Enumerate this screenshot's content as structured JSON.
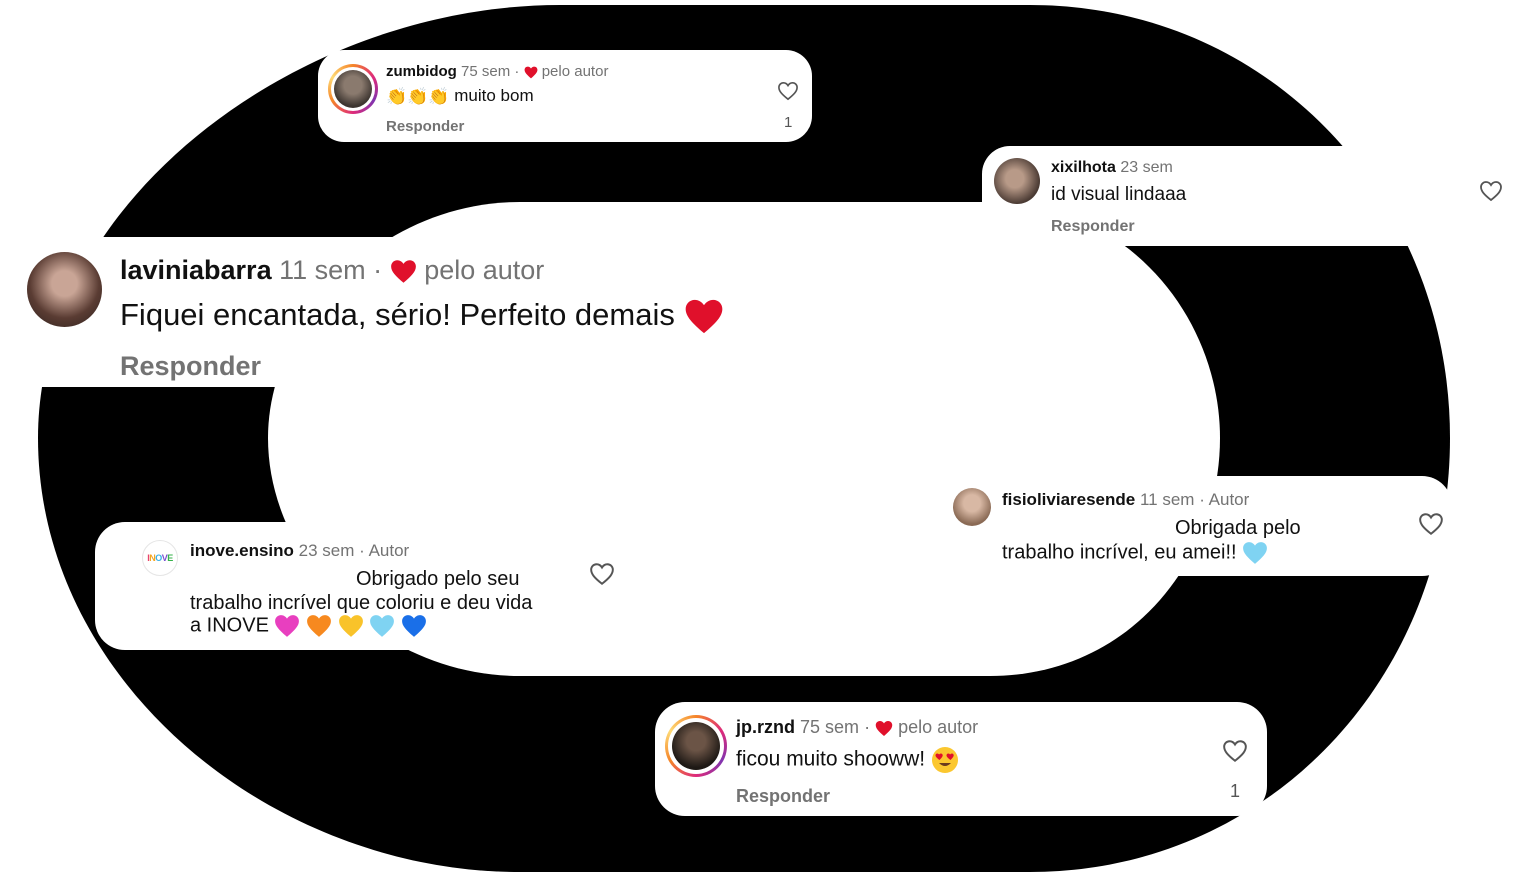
{
  "comments": [
    {
      "username": "zumbidog",
      "age": "75 sem",
      "separator": "·",
      "author_tag": "pelo autor",
      "text": "muito bom",
      "emoji_prefix": [
        "clapping-hands",
        "clapping-hands",
        "clapping-hands"
      ],
      "reply": "Responder",
      "likes": "1",
      "has_story_ring": true
    },
    {
      "username": "xixilhota",
      "age": "23 sem",
      "text": "id visual lindaaa",
      "reply": "Responder",
      "has_story_ring": false
    },
    {
      "username": "laviniabarra",
      "age": "11 sem",
      "separator": "·",
      "author_tag": "pelo autor",
      "text": "Fiquei encantada, sério! Perfeito demais",
      "emoji_suffix": [
        "red-heart"
      ],
      "reply": "Responder",
      "has_story_ring": false
    },
    {
      "username": "fisioliviaresende",
      "age": "11 sem",
      "author_tag": "· Autor",
      "text_line1": "Obrigada pelo",
      "text_line2": "trabalho incrível, eu amei!!",
      "emoji_suffix": [
        "light-blue-heart"
      ],
      "has_story_ring": false
    },
    {
      "username": "inove.ensino",
      "age": "23 sem",
      "author_tag": "· Autor",
      "text_line1": "Obrigado pelo seu",
      "text_line2": "trabalho incrível que coloriu e deu vida",
      "text_line3": "a INOVE",
      "emoji_suffix": [
        "pink-heart",
        "orange-heart",
        "yellow-heart",
        "light-blue-heart",
        "blue-heart"
      ],
      "avatar_logo": "INOVE",
      "has_story_ring": false
    },
    {
      "username": "jp.rznd",
      "age": "75 sem",
      "separator": "·",
      "author_tag": "pelo autor",
      "text": "ficou muito shooww!",
      "emoji_suffix": [
        "heart-eyes-face"
      ],
      "reply": "Responder",
      "likes": "1",
      "has_story_ring": true
    }
  ],
  "colors": {
    "background_shape": "#000000",
    "card": "#ffffff",
    "author_heart": "#e0102b",
    "meta_text": "#737373"
  }
}
